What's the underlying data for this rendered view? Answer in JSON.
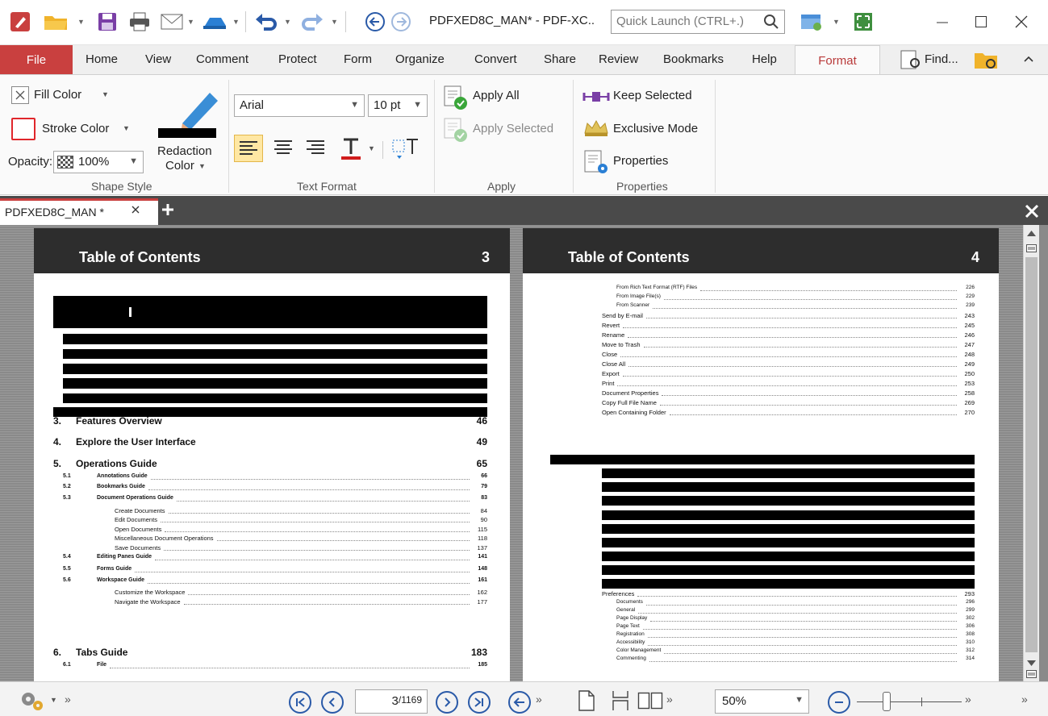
{
  "window": {
    "title": "PDFXED8C_MAN* - PDF-XC..",
    "quick_launch_placeholder": "Quick Launch (CTRL+.)"
  },
  "menu": {
    "file": "File",
    "items": [
      "Home",
      "View",
      "Comment",
      "Protect",
      "Form",
      "Organize",
      "Convert",
      "Share",
      "Review",
      "Bookmarks",
      "Help"
    ],
    "active": "Format",
    "find": "Find..."
  },
  "ribbon": {
    "shape_style": {
      "fill_color": "Fill Color",
      "stroke_color": "Stroke Color",
      "opacity_label": "Opacity:",
      "opacity_value": "100%",
      "redaction_color_1": "Redaction",
      "redaction_color_2": "Color",
      "group_label": "Shape Style"
    },
    "text_format": {
      "font": "Arial",
      "size": "10 pt",
      "group_label": "Text Format"
    },
    "apply": {
      "apply_all": "Apply All",
      "apply_selected": "Apply Selected",
      "group_label": "Apply"
    },
    "properties": {
      "keep_selected": "Keep Selected",
      "exclusive_mode": "Exclusive Mode",
      "properties": "Properties",
      "group_label": "Properties"
    }
  },
  "document_tab": {
    "name": "PDFXED8C_MAN *"
  },
  "left_page": {
    "header_title": "Table of Contents",
    "header_number": "3",
    "entries": [
      {
        "num": "3.",
        "title": "Features Overview",
        "page": "46",
        "level": 0
      },
      {
        "num": "4.",
        "title": "Explore the User Interface",
        "page": "49",
        "level": 0
      },
      {
        "num": "5.",
        "title": "Operations Guide",
        "page": "65",
        "level": 0
      },
      {
        "num": "5.1",
        "title": "Annotations Guide",
        "page": "66",
        "level": 1
      },
      {
        "num": "5.2",
        "title": "Bookmarks Guide",
        "page": "79",
        "level": 1
      },
      {
        "num": "5.3",
        "title": "Document Operations Guide",
        "page": "83",
        "level": 1
      },
      {
        "num": "",
        "title": "Create Documents",
        "page": "84",
        "level": 2
      },
      {
        "num": "",
        "title": "Edit Documents",
        "page": "90",
        "level": 2
      },
      {
        "num": "",
        "title": "Open Documents",
        "page": "115",
        "level": 2
      },
      {
        "num": "",
        "title": "Miscellaneous Document Operations",
        "page": "118",
        "level": 2
      },
      {
        "num": "",
        "title": "Save Documents",
        "page": "137",
        "level": 2
      },
      {
        "num": "5.4",
        "title": "Editing Panes Guide",
        "page": "141",
        "level": 1
      },
      {
        "num": "5.5",
        "title": "Forms Guide",
        "page": "148",
        "level": 1
      },
      {
        "num": "5.6",
        "title": "Workspace Guide",
        "page": "161",
        "level": 1
      },
      {
        "num": "",
        "title": "Customize the Workspace",
        "page": "162",
        "level": 2
      },
      {
        "num": "",
        "title": "Navigate the Workspace",
        "page": "177",
        "level": 2
      },
      {
        "num": "6.",
        "title": "Tabs Guide",
        "page": "183",
        "level": 0
      },
      {
        "num": "6.1",
        "title": "File",
        "page": "185",
        "level": 1
      }
    ]
  },
  "right_page": {
    "header_title": "Table of Contents",
    "header_number": "4",
    "entries_top": [
      {
        "title": "From Rich Text Format (RTF) Files",
        "page": "226",
        "level": 2
      },
      {
        "title": "From Image File(s)",
        "page": "229",
        "level": 2
      },
      {
        "title": "From Scanner",
        "page": "239",
        "level": 2
      },
      {
        "title": "Send by E-mail",
        "page": "243",
        "level": 1
      },
      {
        "title": "Revert",
        "page": "245",
        "level": 1
      },
      {
        "title": "Rename",
        "page": "246",
        "level": 1
      },
      {
        "title": "Move to Trash",
        "page": "247",
        "level": 1
      },
      {
        "title": "Close",
        "page": "248",
        "level": 1
      },
      {
        "title": "Close All",
        "page": "249",
        "level": 1
      },
      {
        "title": "Export",
        "page": "250",
        "level": 1
      },
      {
        "title": "Print",
        "page": "253",
        "level": 1
      },
      {
        "title": "Document Properties",
        "page": "258",
        "level": 1
      },
      {
        "title": "Copy Full File Name",
        "page": "269",
        "level": 1
      },
      {
        "title": "Open Containing Folder",
        "page": "270",
        "level": 1
      }
    ],
    "entries_bottom": [
      {
        "title": "Preferences",
        "page": "293",
        "level": 1
      },
      {
        "title": "Documents",
        "page": "296",
        "level": 2
      },
      {
        "title": "General",
        "page": "299",
        "level": 2
      },
      {
        "title": "Page Display",
        "page": "302",
        "level": 2
      },
      {
        "title": "Page Text",
        "page": "306",
        "level": 2
      },
      {
        "title": "Registration",
        "page": "308",
        "level": 2
      },
      {
        "title": "Accessibility",
        "page": "310",
        "level": 2
      },
      {
        "title": "Color Management",
        "page": "312",
        "level": 2
      },
      {
        "title": "Commenting",
        "page": "314",
        "level": 2
      }
    ]
  },
  "status": {
    "page_current": "3",
    "page_total": "/1169",
    "zoom": "50%"
  },
  "colors": {
    "accent": "#c9403f",
    "nav_blue": "#2a5aa8",
    "page_header": "#2d2d2d",
    "workspace": "#8a8a8a"
  }
}
